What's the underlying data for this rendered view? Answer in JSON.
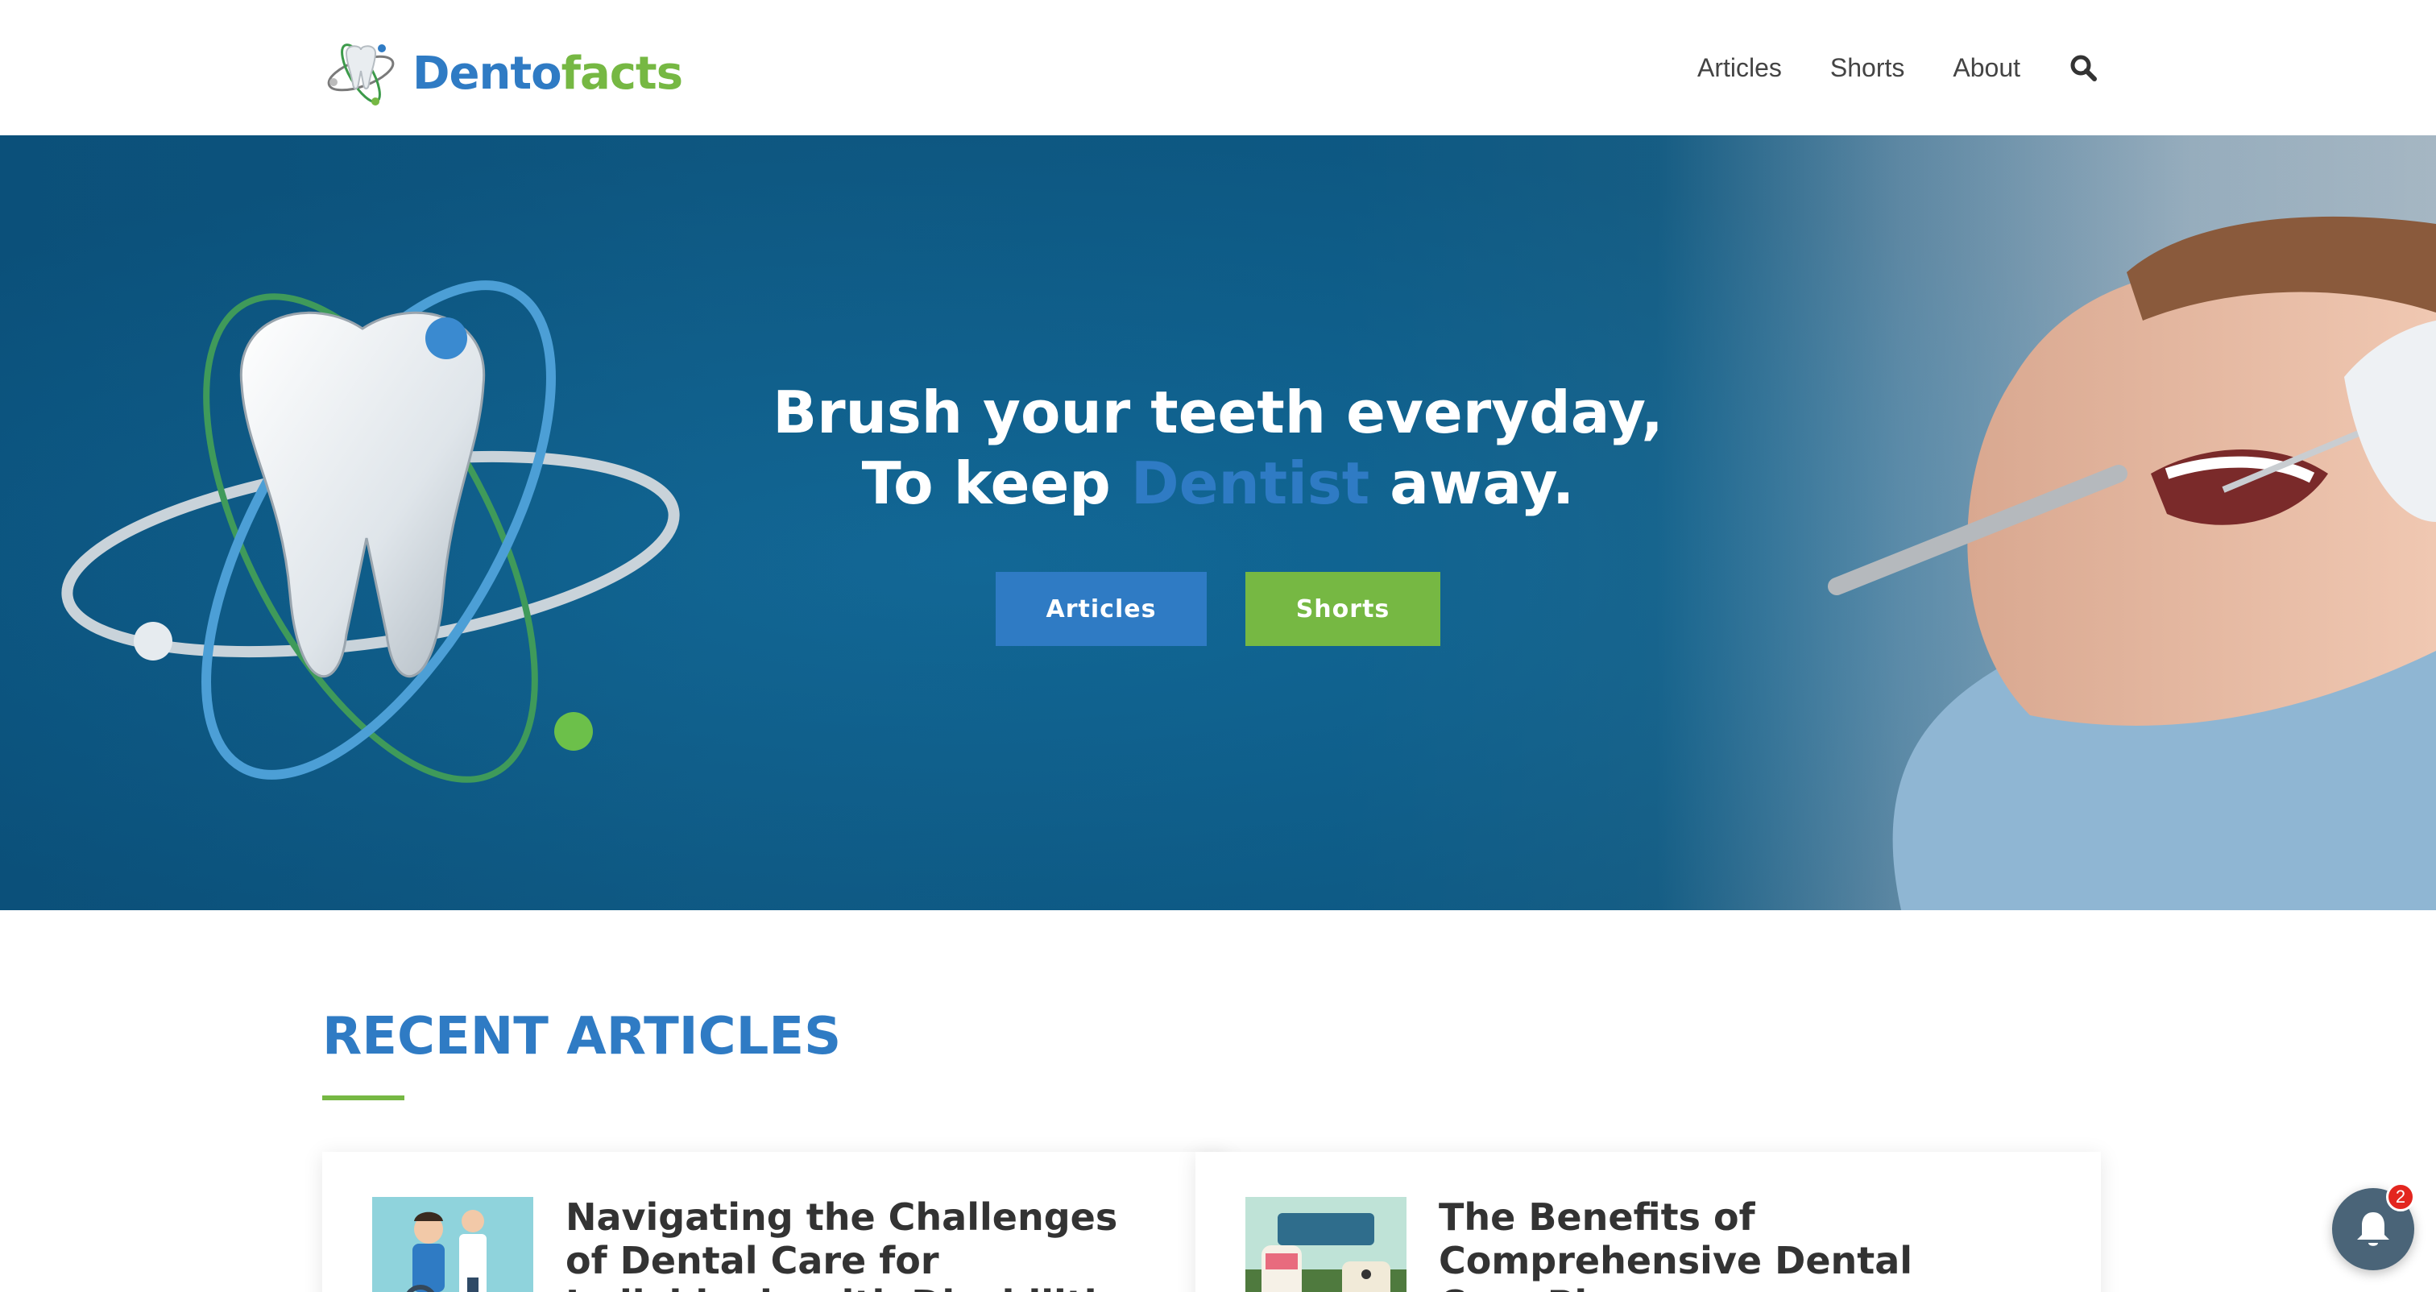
{
  "header": {
    "logo": {
      "part1": "Dento",
      "part2": "facts"
    },
    "nav": [
      {
        "label": "Articles"
      },
      {
        "label": "Shorts"
      },
      {
        "label": "About"
      }
    ],
    "search_icon": "search-icon"
  },
  "hero": {
    "title_line1": "Brush your teeth everyday,",
    "title_line2_pre": "To keep ",
    "title_line2_accent": "Dentist",
    "title_line2_post": " away.",
    "buttons": {
      "articles": "Articles",
      "shorts": "Shorts"
    }
  },
  "recent": {
    "heading": "RECENT ARTICLES",
    "cards": [
      {
        "title": "Navigating the Challenges of Dental Care for Individuals with Disabilities"
      },
      {
        "title": "The Benefits of Comprehensive Dental Care Plans"
      }
    ]
  },
  "notifications": {
    "count": "2",
    "icon": "bell-icon"
  },
  "colors": {
    "brand_blue": "#2f7bc4",
    "brand_green": "#76b843",
    "badge_red": "#e3261f"
  }
}
